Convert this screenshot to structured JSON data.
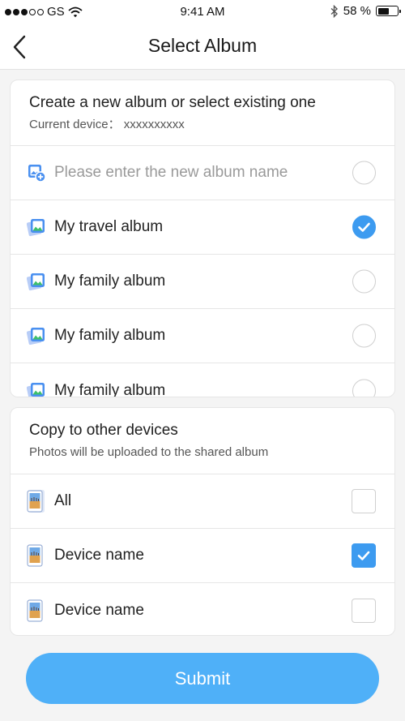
{
  "status_bar": {
    "carrier": "GS",
    "time": "9:41 AM",
    "battery": "58 %",
    "battery_level": 0.58,
    "signal_icon": "signal-dots-icon",
    "wifi_icon": "wifi-icon",
    "bluetooth_icon": "bluetooth-icon"
  },
  "nav": {
    "title": "Select Album",
    "back_icon": "chevron-left-icon"
  },
  "album_section": {
    "title": "Create a new album or select existing one",
    "device_line": "Current device： xxxxxxxxxx",
    "new_album_placeholder": "Please enter the new album name",
    "items": [
      {
        "label": "My travel album",
        "selected": true
      },
      {
        "label": "My family album",
        "selected": false
      },
      {
        "label": "My family album",
        "selected": false
      },
      {
        "label": "My family album",
        "selected": false
      }
    ]
  },
  "devices_section": {
    "title": "Copy to other devices",
    "subtitle": "Photos will be uploaded to the shared album",
    "items": [
      {
        "label": "All",
        "checked": false
      },
      {
        "label": "Device name",
        "checked": true
      },
      {
        "label": "Device name",
        "checked": false
      }
    ]
  },
  "submit_label": "Submit",
  "colors": {
    "accent": "#3d9bf0",
    "submit": "#4fb0f8"
  }
}
